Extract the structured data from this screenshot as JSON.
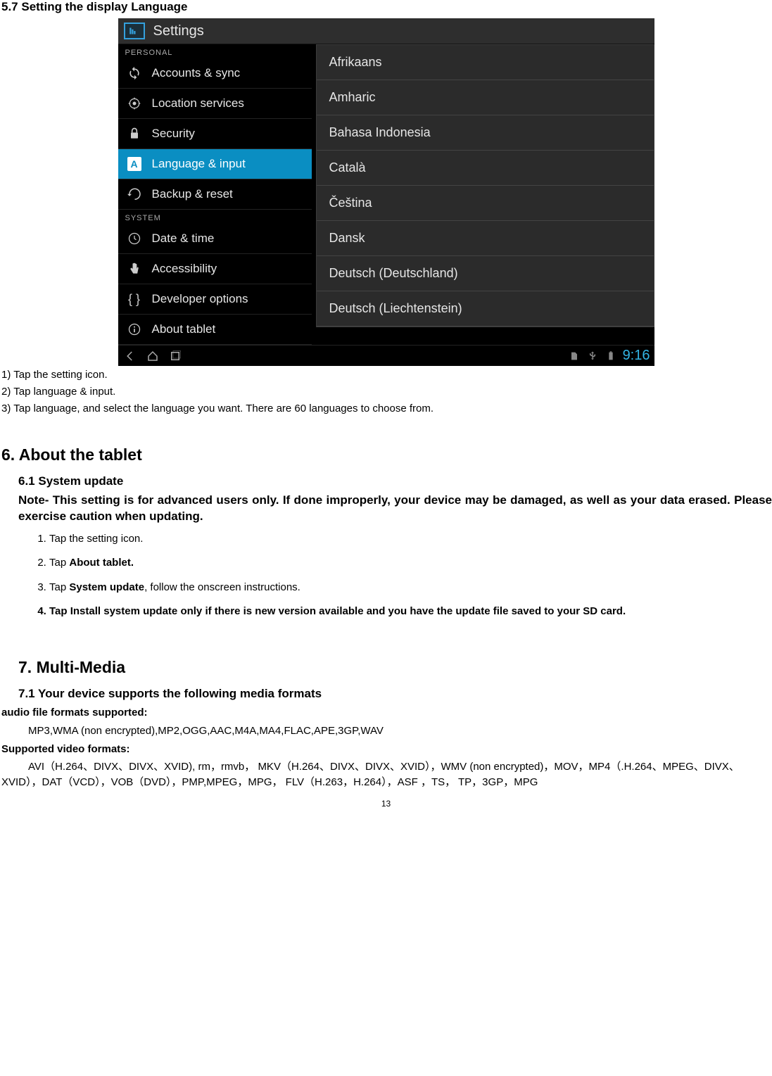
{
  "section57": {
    "heading": "5.7  Setting the display Language",
    "step1": "1) Tap the setting icon.",
    "step2": "2) Tap language & input.",
    "step3": "3) Tap language, and select the language you want. There are 60 languages to choose from."
  },
  "android": {
    "header_title": "Settings",
    "personal_label": "PERSONAL",
    "system_label": "SYSTEM",
    "sidebar": {
      "accounts": "Accounts & sync",
      "location": "Location services",
      "security": "Security",
      "language": "Language & input",
      "backup": "Backup & reset",
      "date": "Date & time",
      "accessibility": "Accessibility",
      "developer": "Developer options",
      "about": "About tablet"
    },
    "languages": {
      "l1": "Afrikaans",
      "l2": "Amharic",
      "l3": "Bahasa Indonesia",
      "l4": "Català",
      "l5": "Čeština",
      "l6": "Dansk",
      "l7": "Deutsch (Deutschland)",
      "l8": "Deutsch (Liechtenstein)"
    },
    "clock": "9:16"
  },
  "section6": {
    "heading": "6. About the tablet",
    "sub": "6.1 System update",
    "note": "Note- This setting is for advanced users only. If done improperly, your device may be damaged, as well as your data erased. Please exercise caution when updating.",
    "li1": "Tap the setting icon.",
    "li2a": "Tap ",
    "li2b": "About tablet.",
    "li3a": "Tap ",
    "li3b": "System update",
    "li3c": ", follow the onscreen instructions.",
    "li4": "Tap Install system update only if there is new version available and you have the update file saved to your SD card."
  },
  "section7": {
    "heading": "7. Multi-Media",
    "sub": "7.1 Your device supports the following media formats",
    "audio_label": "audio file formats supported:",
    "audio_list": "MP3,WMA (non encrypted),MP2,OGG,AAC,M4A,MA4,FLAC,APE,3GP,WAV",
    "video_label": "Supported video formats:",
    "video_list": "AVI（H.264、DIVX、DIVX、XVID), rm，rmvb，  MKV（H.264、DIVX、DIVX、XVID），WMV (non encrypted)，MOV，MP4（.H.264、MPEG、DIVX、XVID），DAT（VCD），VOB（DVD），PMP,MPEG，MPG，  FLV（H.263，H.264），ASF  ，TS，  TP，3GP，MPG"
  },
  "pagenum": "13"
}
